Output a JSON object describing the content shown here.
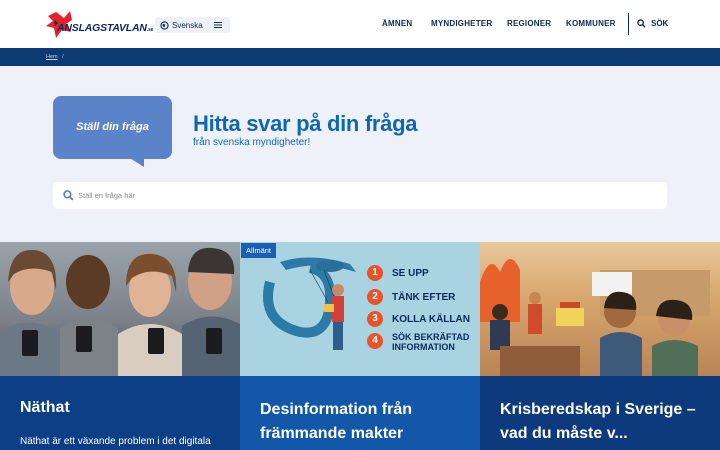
{
  "header": {
    "logo_text": "ANSLAGSTAVLAN",
    "logo_suffix": ".se",
    "language": "Svenska",
    "nav": [
      "ÄMNEN",
      "MYNDIGHETER",
      "REGIONER",
      "KOMMUNER"
    ],
    "search_label": "SÖK"
  },
  "breadcrumb": {
    "home": "Hem",
    "sep": "/"
  },
  "hero": {
    "bubble_text": "Ställ din fråga",
    "title": "Hitta svar på din fråga",
    "subtitle": "från svenska myndigheter!",
    "search_placeholder": "Ställ en fråga här"
  },
  "cards": [
    {
      "title": "Näthat",
      "text": "Näthat är ett växande problem i det digitala"
    },
    {
      "tag": "Allmänt",
      "title": "Desinformation från främmande makter",
      "list": [
        "SE UPP",
        "TÄNK EFTER",
        "KOLLA KÄLLAN",
        "SÖK BEKRÄFTAD INFORMATION"
      ],
      "list_numbers": [
        "1",
        "2",
        "3",
        "4"
      ]
    },
    {
      "title": "Krisberedskap i Sverige – vad du måste v..."
    }
  ],
  "colors": {
    "navy": "#0b2a5b",
    "topbar": "#0b3a75",
    "hero_bg": "#eef2f8",
    "accent_blue": "#0f67b1",
    "card1": "#0d3f86",
    "card2": "#1358a8",
    "card3": "#0c3a7d",
    "logo_red": "#e2232b"
  }
}
